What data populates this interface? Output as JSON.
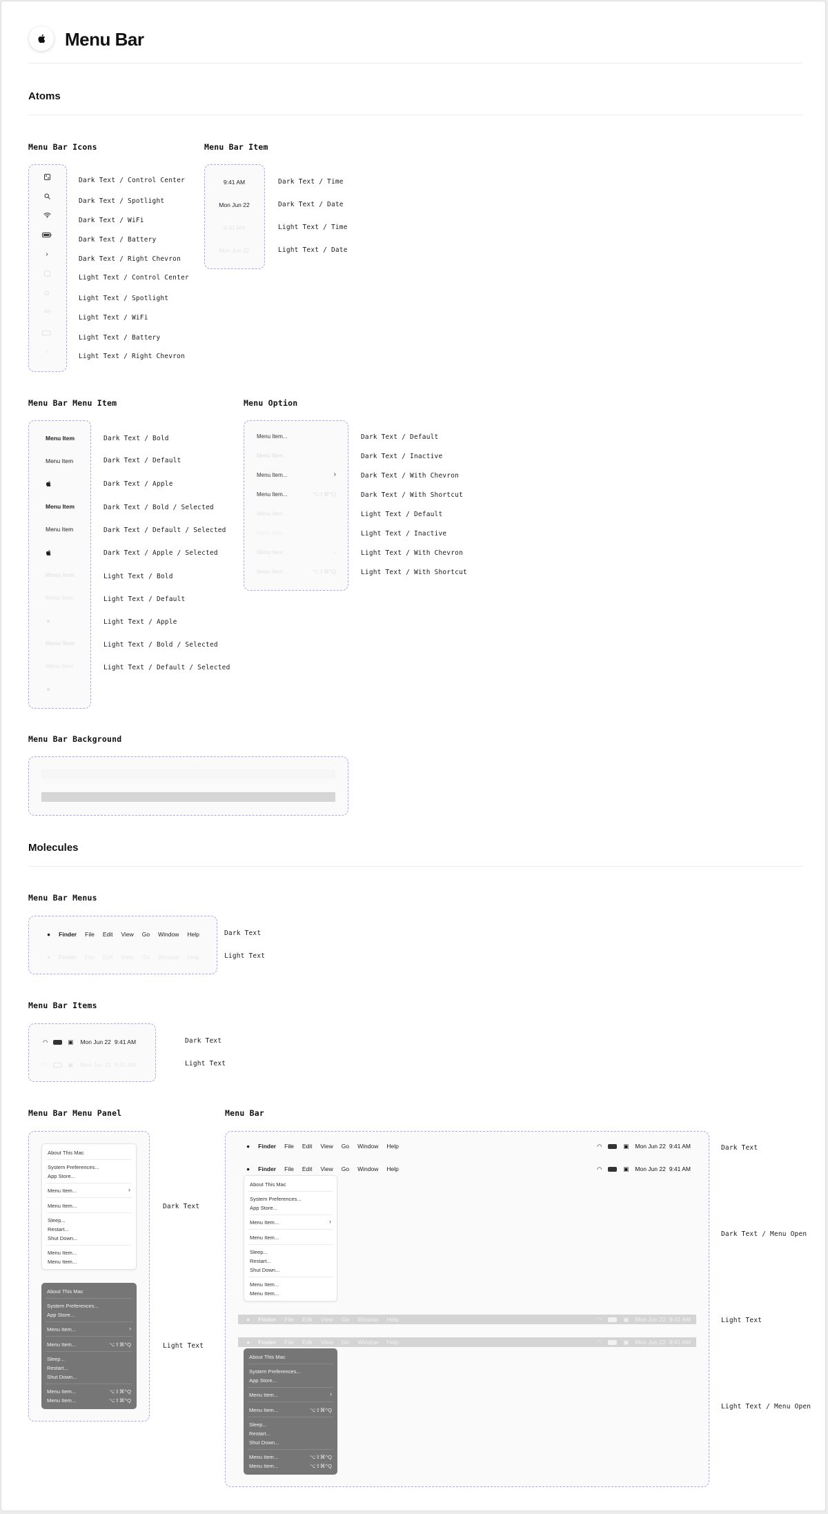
{
  "header": {
    "title": "Menu Bar",
    "logo_icon": "apple-logo-icon"
  },
  "sections": {
    "atoms": "Atoms",
    "molecules": "Molecules"
  },
  "icons_group": {
    "title": "Menu Bar Icons",
    "labels": [
      "Dark Text / Control Center",
      "Dark Text / Spotlight",
      "Dark Text / WiFi",
      "Dark Text / Battery",
      "Dark Text / Right Chevron",
      "Light Text / Control Center",
      "Light Text / Spotlight",
      "Light Text / WiFi",
      "Light Text / Battery",
      "Light Text / Right Chevron"
    ],
    "icons": [
      "control-center-icon",
      "search-icon",
      "wifi-icon",
      "battery-icon",
      "chevron-right-icon"
    ]
  },
  "item_group": {
    "title": "Menu Bar Item",
    "values": [
      "9:41 AM",
      "Mon Jun 22",
      "9:41 AM",
      "Mon Jun 22"
    ],
    "labels": [
      "Dark Text / Time",
      "Dark Text / Date",
      "Light Text / Time",
      "Light Text / Date"
    ]
  },
  "menu_item_group": {
    "title": "Menu Bar Menu Item",
    "item_text": "Menu Item",
    "labels": [
      "Dark Text / Bold",
      "Dark Text / Default",
      "Dark Text / Apple",
      "Dark Text / Bold / Selected",
      "Dark Text / Default / Selected",
      "Dark Text / Apple / Selected",
      "Light Text / Bold",
      "Light Text / Default",
      "Light Text / Apple",
      "Light Text / Bold / Selected",
      "Light Text / Default / Selected"
    ]
  },
  "option_group": {
    "title": "Menu Option",
    "item_text": "Menu Item...",
    "shortcut": "⌥⇧⌘^Q",
    "labels": [
      "Dark Text / Default",
      "Dark Text / Inactive",
      "Dark Text / With Chevron",
      "Dark Text / With Shortcut",
      "Light Text / Default",
      "Light Text / Inactive",
      "Light Text / With Chevron",
      "Light Text / With Shortcut"
    ]
  },
  "background_group": {
    "title": "Menu Bar Background"
  },
  "menus_group": {
    "title": "Menu Bar Menus",
    "menus": [
      "Finder",
      "File",
      "Edit",
      "View",
      "Go",
      "Window",
      "Help"
    ],
    "labels": [
      "Dark Text",
      "Light Text"
    ]
  },
  "items_group": {
    "title": "Menu Bar Items",
    "date": "Mon Jun 22",
    "time": "9:41 AM",
    "labels": [
      "Dark Text",
      "Light Text"
    ]
  },
  "panel_group": {
    "title": "Menu Bar Menu Panel",
    "labels": [
      "Dark Text",
      "Light Text"
    ],
    "items": [
      "About This Mac",
      "System Preferences...",
      "App Store...",
      "Menu Item...",
      "Menu Item...",
      "Sleep...",
      "Restart...",
      "Shut Down...",
      "Menu Item...",
      "Menu Item..."
    ],
    "shortcut": "⌥⇧⌘^Q"
  },
  "menubar_group": {
    "title": "Menu Bar",
    "labels": [
      "Dark Text",
      "Dark Text / Menu Open",
      "Light Text",
      "Light Text / Menu Open"
    ]
  },
  "colors": {
    "accent_dash": "#aea5f2",
    "panel_dark": "#767676",
    "bar_gray": "#d4d4d4"
  }
}
